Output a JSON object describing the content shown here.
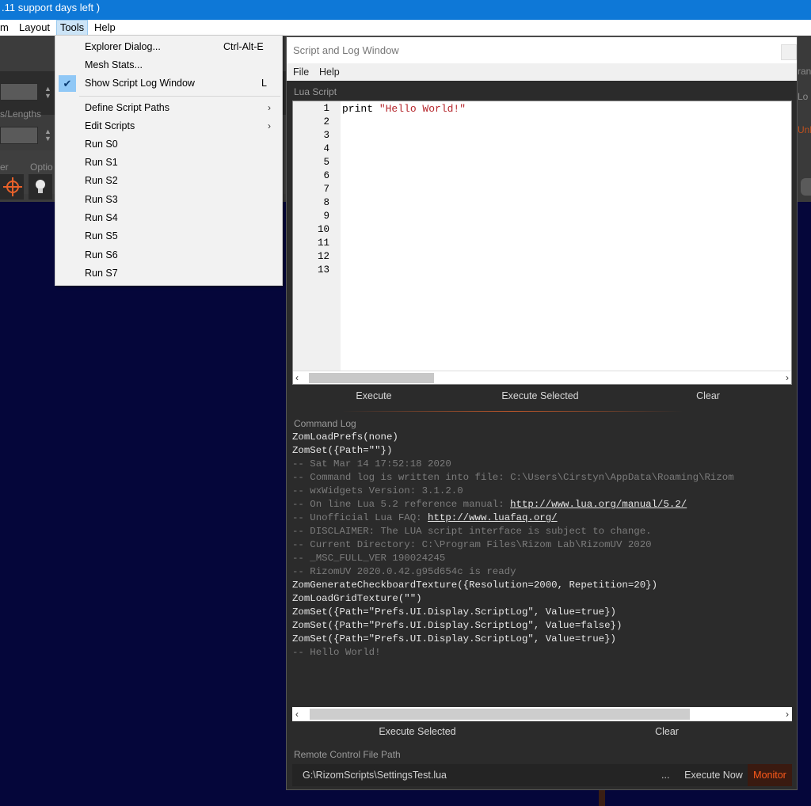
{
  "window": {
    "title_fragment": ".11 support days left )"
  },
  "menubar": {
    "items": [
      {
        "label": "m"
      },
      {
        "label": "Layout"
      },
      {
        "label": "Tools"
      },
      {
        "label": "Help"
      }
    ]
  },
  "toolbar": {
    "lengths_label": "s/Lengths",
    "options_label": "Optio",
    "er_label": "er",
    "right_labels": [
      "ran",
      "Lo",
      "Unl"
    ]
  },
  "tools_menu": {
    "items": [
      {
        "label": "Explorer Dialog...",
        "shortcut": "Ctrl-Alt-E"
      },
      {
        "label": "Mesh Stats...",
        "shortcut": ""
      },
      {
        "label": "Show Script Log Window",
        "shortcut": "L",
        "checked": true
      },
      {
        "label": "Define Script Paths",
        "submenu": true
      },
      {
        "label": "Edit Scripts",
        "submenu": true
      },
      {
        "label": "Run S0"
      },
      {
        "label": "Run S1"
      },
      {
        "label": "Run S2"
      },
      {
        "label": "Run S3"
      },
      {
        "label": "Run S4"
      },
      {
        "label": "Run S5"
      },
      {
        "label": "Run S6"
      },
      {
        "label": "Run S7"
      }
    ]
  },
  "script_window": {
    "title": "Script and Log Window",
    "menu": [
      "File",
      "Help"
    ],
    "lua_script_label": "Lua Script",
    "line_numbers": [
      "1",
      "2",
      "3",
      "4",
      "5",
      "6",
      "7",
      "8",
      "9",
      "10",
      "11",
      "12",
      "13"
    ],
    "code_keyword": "print ",
    "code_string": "\"Hello World!\"",
    "buttons": {
      "execute": "Execute",
      "execute_selected": "Execute Selected",
      "clear": "Clear"
    },
    "command_log_label": "Command Log",
    "log_lines": [
      {
        "text": "ZomLoadPrefs(none)",
        "type": "cmd"
      },
      {
        "text": "ZomSet({Path=\"\"})",
        "type": "cmd"
      },
      {
        "text": "-- Sat Mar 14 17:52:18 2020",
        "type": "cmt"
      },
      {
        "text": "-- Command log is written into file: C:\\Users\\Cirstyn\\AppData\\Roaming\\Rizom",
        "type": "cmt"
      },
      {
        "text": "-- wxWidgets Version: 3.1.2.0",
        "type": "cmt"
      },
      {
        "text": "-- On line Lua 5.2 reference manual: ",
        "type": "cmt",
        "link": "http://www.lua.org/manual/5.2/"
      },
      {
        "text": "-- Unofficial Lua FAQ: ",
        "type": "cmt",
        "link": "http://www.luafaq.org/"
      },
      {
        "text": "-- DISCLAIMER: The LUA script interface is subject to change.",
        "type": "cmt"
      },
      {
        "text": "-- Current Directory: C:\\Program Files\\Rizom Lab\\RizomUV 2020",
        "type": "cmt"
      },
      {
        "text": "-- _MSC_FULL_VER 190024245",
        "type": "cmt"
      },
      {
        "text": "-- RizomUV 2020.0.42.g95d654c is ready",
        "type": "cmt"
      },
      {
        "text": "ZomGenerateCheckboardTexture({Resolution=2000, Repetition=20})",
        "type": "cmd"
      },
      {
        "text": "ZomLoadGridTexture(\"\")",
        "type": "cmd"
      },
      {
        "text": "ZomSet({Path=\"Prefs.UI.Display.ScriptLog\", Value=true})",
        "type": "cmd"
      },
      {
        "text": "ZomSet({Path=\"Prefs.UI.Display.ScriptLog\", Value=false})",
        "type": "cmd"
      },
      {
        "text": "ZomSet({Path=\"Prefs.UI.Display.ScriptLog\", Value=true})",
        "type": "cmd"
      },
      {
        "text": "-- Hello World!",
        "type": "cmt"
      }
    ],
    "log_buttons": {
      "execute_selected": "Execute Selected",
      "clear": "Clear"
    },
    "remote_label": "Remote Control File Path",
    "remote_path": "G:\\RizomScripts\\SettingsTest.lua",
    "browse": "...",
    "execute_now": "Execute Now",
    "monitor": "Monitor"
  },
  "colors": {
    "titlebar": "#0e78d7",
    "viewport": "#05063a",
    "accent_orange": "#ff5a1a"
  }
}
